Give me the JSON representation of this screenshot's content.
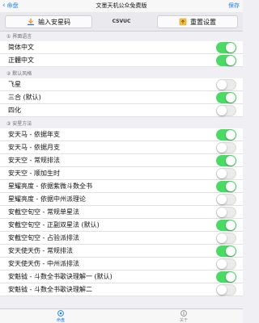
{
  "nav": {
    "back_label": "命盘",
    "title": "文墨天机公众免费版",
    "save_label": "保存"
  },
  "toolbar": {
    "left_label": "输入安星码",
    "center_label": "CSVUC",
    "right_label": "重置设置"
  },
  "sections": [
    {
      "header": "① 界面语言",
      "rows": [
        {
          "label": "简体中文",
          "on": true
        },
        {
          "label": "正體中文",
          "on": false
        }
      ]
    },
    {
      "header": "② 默认风格",
      "rows": [
        {
          "label": "飞星",
          "on": false
        },
        {
          "label": "三合 (默认)",
          "on": true
        },
        {
          "label": "四化",
          "on": false
        }
      ]
    },
    {
      "header": "③ 安星方法",
      "rows": [
        {
          "label": "安天马 - 依据年支",
          "on": true
        },
        {
          "label": "安天马 - 依据月支",
          "on": false
        },
        {
          "label": "安天空 - 常规排法",
          "on": true
        },
        {
          "label": "安天空 - 顺加生时",
          "on": false
        },
        {
          "label": "星耀亮度 - 依据紫微斗数全书",
          "on": true
        },
        {
          "label": "星耀亮度 - 依据中州派理论",
          "on": false
        },
        {
          "label": "安截空旬空 - 常规单星法",
          "on": false
        },
        {
          "label": "安截空旬空 - 正副双星法 (默认)",
          "on": true
        },
        {
          "label": "安截空旬空 - 占验派排法",
          "on": false
        },
        {
          "label": "安天使天伤 - 常规排法",
          "on": true
        },
        {
          "label": "安天使天伤 - 中州派排法",
          "on": false
        },
        {
          "label": "安魁钺 - 斗数全书歌诀理解一 (默认)",
          "on": true
        },
        {
          "label": "安魁钺 - 斗数全书歌诀理解二",
          "on": false
        }
      ]
    }
  ],
  "tabs": [
    {
      "label": "命盘",
      "icon": "chart-icon"
    },
    {
      "label": "关于",
      "icon": "info-icon"
    }
  ],
  "colors": {
    "accent": "#1b7cf0",
    "toggle_on": "#4cd964",
    "background": "#efeff4"
  }
}
